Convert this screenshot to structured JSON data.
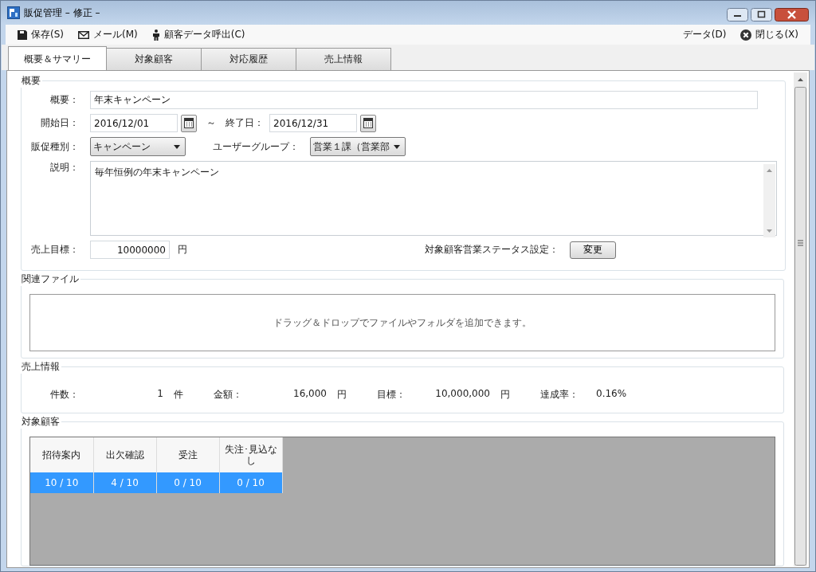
{
  "window": {
    "title": "販促管理 – 修正 –"
  },
  "toolbar": {
    "left": [
      {
        "kind": "save",
        "label": "保存(S)"
      },
      {
        "kind": "mail",
        "label": "メール(M)"
      },
      {
        "kind": "person",
        "label": "顧客データ呼出(C)"
      }
    ],
    "right": [
      {
        "kind": "plain",
        "label": "データ(D)"
      },
      {
        "kind": "close",
        "label": "閉じる(X)"
      }
    ]
  },
  "tabs": [
    {
      "label": "概要＆サマリー",
      "selected": true
    },
    {
      "label": "対象顧客",
      "selected": false
    },
    {
      "label": "対応履歴",
      "selected": false
    },
    {
      "label": "売上情報",
      "selected": false
    }
  ],
  "overview": {
    "title": "概要",
    "summary": {
      "label": "概要：",
      "value": "年末キャンペーン"
    },
    "start": {
      "label": "開始日：",
      "value": "2016/12/01"
    },
    "range_sep": "～",
    "end": {
      "label": "終了日：",
      "value": "2016/12/31"
    },
    "type": {
      "label": "販促種別：",
      "value": "キャンペーン"
    },
    "group": {
      "label": "ユーザーグループ：",
      "value": "営業１課（営業部"
    },
    "description": {
      "label": "説明：",
      "value": "毎年恒例の年末キャンペーン"
    },
    "target": {
      "label": "売上目標：",
      "value": "10000000",
      "unit": "円"
    },
    "status": {
      "label": "対象顧客営業ステータス設定：",
      "button": "変更"
    }
  },
  "files": {
    "title": "関連ファイル",
    "hint": "ドラッグ＆ドロップでファイルやフォルダを追加できます。"
  },
  "sales": {
    "title": "売上情報",
    "stats": [
      {
        "label": "件数：",
        "value": "1",
        "unit": "件"
      },
      {
        "label": "金額：",
        "value": "16,000",
        "unit": "円"
      },
      {
        "label": "目標：",
        "value": "10,000,000",
        "unit": "円"
      },
      {
        "label": "達成率：",
        "value": "0.16%"
      }
    ]
  },
  "customers": {
    "title": "対象顧客",
    "columns": [
      "招待案内",
      "出欠確認",
      "受注",
      "失注･見込なし"
    ],
    "rows": [
      {
        "cells": [
          "10 / 10",
          "4 / 10",
          "0 / 10",
          "0 / 10"
        ],
        "selected": true
      }
    ]
  }
}
